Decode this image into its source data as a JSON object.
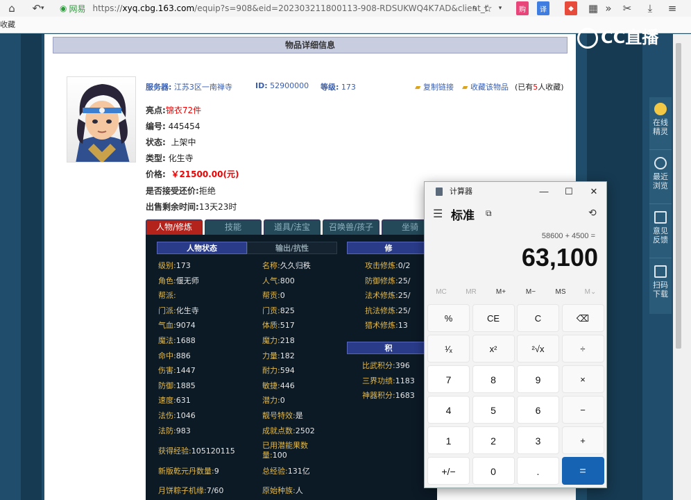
{
  "browser": {
    "url_secure": "网易",
    "url_scheme": "https://",
    "url_host": "xyq.cbg.163.com",
    "url_path": "/equip?s=908&eid=202303211800113-908-RDSUKWQ4K7AD&client_t",
    "bookmarks_label": "收藏",
    "ext_labels": [
      "购",
      "译"
    ],
    "more_label": "»"
  },
  "page": {
    "header_title": "物品详细信息",
    "server_label": "服务器:",
    "server_value": "江苏3区一南禅寺",
    "id_label": "ID:",
    "id_value": "52900000",
    "level_label": "等级:",
    "level_value": "173",
    "copy_link": "复制链接",
    "favorite": "收藏该物品",
    "fav_count_prefix": "(已有",
    "fav_count": "5",
    "fav_count_suffix": "人收藏)",
    "highlight_label": "亮点:",
    "highlight_value": "锦衣72件",
    "serial_label": "编号:",
    "serial_value": "445454",
    "status_label": "状态:",
    "status_value": "上架中",
    "type_label": "类型:",
    "type_value": "化生寺",
    "price_label": "价格:",
    "price_value": "￥21500.00(元)",
    "bargain_label": "是否接受还价:",
    "bargain_value": "拒绝",
    "remaining_label": "出售剩余时间:",
    "remaining_value": "13天23时"
  },
  "tabs": [
    "人物/修炼",
    "技能",
    "道具/法宝",
    "召唤兽/孩子",
    "坐骑",
    "",
    ""
  ],
  "panel": {
    "subtab_active": "人物状态",
    "subtab_other": "输出/抗性",
    "subtab_right": "修",
    "subtab_right2": "积",
    "col1": [
      {
        "k": "级别:",
        "v": "173"
      },
      {
        "k": "角色:",
        "v": "偃无师"
      },
      {
        "k": "帮派:",
        "v": ""
      },
      {
        "k": "门派:",
        "v": "化生寺"
      },
      {
        "k": "气血:",
        "v": "9074"
      },
      {
        "k": "魔法:",
        "v": "1688"
      },
      {
        "k": "命中:",
        "v": "886"
      },
      {
        "k": "伤害:",
        "v": "1447"
      },
      {
        "k": "防御:",
        "v": "1885"
      },
      {
        "k": "速度:",
        "v": "631"
      },
      {
        "k": "法伤:",
        "v": "1046"
      },
      {
        "k": "法防:",
        "v": "983"
      },
      {
        "k": "获得经验:",
        "v": "105120115"
      },
      {
        "k": "新版乾元丹数量:",
        "v": "9"
      },
      {
        "k": "月饼粽子机缘:",
        "v": "7/60"
      }
    ],
    "col2": [
      {
        "k": "名称:",
        "v": "久久归秩"
      },
      {
        "k": "人气:",
        "v": "800"
      },
      {
        "k": "帮贡:",
        "v": "0"
      },
      {
        "k": "门贡:",
        "v": "825"
      },
      {
        "k": "体质:",
        "v": "517"
      },
      {
        "k": "魔力:",
        "v": "218"
      },
      {
        "k": "力量:",
        "v": "182"
      },
      {
        "k": "耐力:",
        "v": "594"
      },
      {
        "k": "敏捷:",
        "v": "446"
      },
      {
        "k": "潜力:",
        "v": "0"
      },
      {
        "k": "靓号特效:",
        "v": "是"
      },
      {
        "k": "成就点数:",
        "v": "2502"
      },
      {
        "k": "已用潜能果数量:",
        "v": "100"
      },
      {
        "k": "总经验:",
        "v": "131亿"
      },
      {
        "k": "原始种族:",
        "v": "人"
      }
    ],
    "col3": [
      {
        "k": "攻击修炼:",
        "v": "0/2"
      },
      {
        "k": "防御修炼:",
        "v": "25/"
      },
      {
        "k": "法术修炼:",
        "v": "25/"
      },
      {
        "k": "抗法修炼:",
        "v": "25/"
      },
      {
        "k": "猎术修炼:",
        "v": "13"
      }
    ],
    "col4": [
      {
        "k": "比武积分:",
        "v": "396"
      },
      {
        "k": "三界功绩:",
        "v": "1183"
      },
      {
        "k": "神器积分:",
        "v": "1683"
      }
    ]
  },
  "sidebar": [
    {
      "label": "在线精灵"
    },
    {
      "label": "最近浏览"
    },
    {
      "label": "意见反馈"
    },
    {
      "label": "扫码下载"
    }
  ],
  "cc_logo": "CC直播",
  "calculator": {
    "title": "计算器",
    "mode": "标准",
    "expression": "58600 + 4500 =",
    "result": "63,100",
    "memory": [
      "MC",
      "MR",
      "M+",
      "M−",
      "MS",
      "M⌄"
    ],
    "keys": [
      [
        "%",
        "CE",
        "C",
        "⌫"
      ],
      [
        "¹⁄ₓ",
        "x²",
        "²√x",
        "÷"
      ],
      [
        "7",
        "8",
        "9",
        "×"
      ],
      [
        "4",
        "5",
        "6",
        "−"
      ],
      [
        "1",
        "2",
        "3",
        "+"
      ],
      [
        "+/−",
        "0",
        ".",
        "="
      ]
    ]
  }
}
